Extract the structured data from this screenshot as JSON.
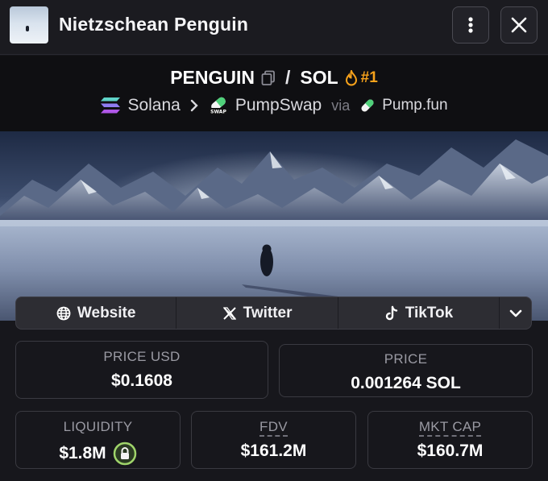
{
  "header": {
    "title": "Nietzschean Penguin"
  },
  "pair": {
    "base_symbol": "PENGUIN",
    "quote_symbol": "SOL",
    "rank": "#1",
    "chain": "Solana",
    "dex": "PumpSwap",
    "via": "via",
    "launchpad": "Pump.fun"
  },
  "links": {
    "website": "Website",
    "twitter": "Twitter",
    "tiktok": "TikTok"
  },
  "stats": {
    "price_usd_label": "PRICE USD",
    "price_usd": "$0.1608",
    "price_label": "PRICE",
    "price": "0.001264 SOL",
    "liquidity_label": "LIQUIDITY",
    "liquidity": "$1.8M",
    "fdv_label": "FDV",
    "fdv": "$161.2M",
    "mktcap_label": "MKT CAP",
    "mktcap": "$160.7M"
  },
  "colors": {
    "accent_rank": "#f7a21b",
    "lock_green": "#9fd46a",
    "background": "#17171c"
  },
  "icons": [
    "more-vertical-icon",
    "close-icon",
    "copy-icon",
    "flame-icon",
    "solana-icon",
    "chevron-right-icon",
    "pumpswap-icon",
    "pill-icon",
    "globe-icon",
    "x-icon",
    "tiktok-icon",
    "chevron-down-icon",
    "lock-icon"
  ]
}
